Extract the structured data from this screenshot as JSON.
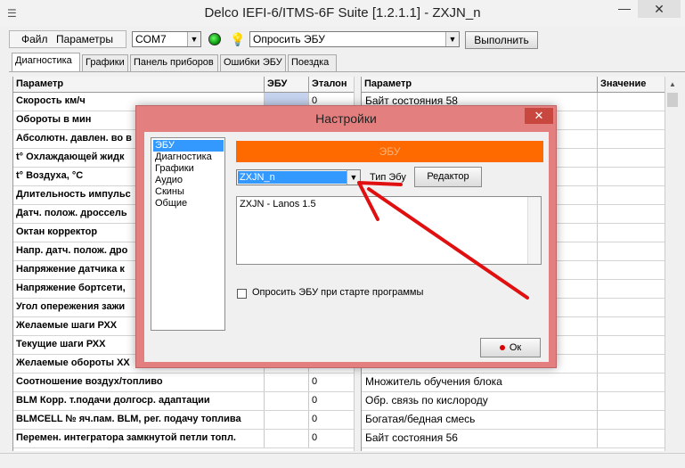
{
  "window": {
    "title": "Delco IEFI-6/ITMS-6F Suite [1.2.1.1] - ZXJN_n",
    "min_glyph": "—",
    "close_glyph": "✕",
    "app_icon": "app-menu-icon"
  },
  "toolbar": {
    "menu": [
      "Файл",
      "Параметры"
    ],
    "port": "COM7",
    "action": "Опросить ЭБУ",
    "execute_label": "Выполнить",
    "led_color": "#00a000"
  },
  "tabs": [
    {
      "label": "Диагностика",
      "active": true
    },
    {
      "label": "Графики",
      "active": false
    },
    {
      "label": "Панель приборов",
      "active": false
    },
    {
      "label": "Ошибки ЭБУ",
      "active": false
    },
    {
      "label": "Поездка",
      "active": false
    }
  ],
  "left_table": {
    "headers": [
      "Параметр",
      "ЭБУ",
      "Эталон"
    ],
    "rows": [
      {
        "name": "Скорость км/ч",
        "ebu": "",
        "ref": "0"
      },
      {
        "name": "Обороты в мин",
        "ebu": "",
        "ref": ""
      },
      {
        "name": "Абсолютн. давлен. во в",
        "ebu": "",
        "ref": ""
      },
      {
        "name": "t° Охлаждающей жидк",
        "ebu": "",
        "ref": ""
      },
      {
        "name": "t° Воздуха, °C",
        "ebu": "",
        "ref": ""
      },
      {
        "name": "Длительность импульс",
        "ebu": "",
        "ref": ""
      },
      {
        "name": "Датч. полож. дроссель",
        "ebu": "",
        "ref": ""
      },
      {
        "name": "Октан корректор",
        "ebu": "",
        "ref": ""
      },
      {
        "name": "Напр. датч. полож. дро",
        "ebu": "",
        "ref": ""
      },
      {
        "name": "Напряжение датчика к",
        "ebu": "",
        "ref": ""
      },
      {
        "name": "Напряжение бортсети,",
        "ebu": "",
        "ref": ""
      },
      {
        "name": "Угол опережения зажи",
        "ebu": "",
        "ref": ""
      },
      {
        "name": "Желаемые шаги РХХ",
        "ebu": "",
        "ref": ""
      },
      {
        "name": "Текущие шаги РХХ",
        "ebu": "",
        "ref": ""
      },
      {
        "name": "Желаемые обороты ХХ",
        "ebu": "",
        "ref": ""
      },
      {
        "name": "Соотношение воздух/топливо",
        "ebu": "",
        "ref": "0"
      },
      {
        "name": "BLM Корр. т.подачи долгоср. адаптации",
        "ebu": "",
        "ref": "0"
      },
      {
        "name": "BLMCELL № яч.пам. BLM, рег. подачу топлива",
        "ebu": "",
        "ref": "0"
      },
      {
        "name": "Перемен. интегратора замкнутой петли топл.",
        "ebu": "",
        "ref": "0"
      }
    ]
  },
  "right_table": {
    "headers": [
      "Параметр",
      "Значение"
    ],
    "rows": [
      {
        "name": "Байт состояния 58",
        "value": ""
      },
      {
        "name": "",
        "value": ""
      },
      {
        "name": "",
        "value": ""
      },
      {
        "name": "",
        "value": ""
      },
      {
        "name": "",
        "value": ""
      },
      {
        "name": "",
        "value": ""
      },
      {
        "name": "",
        "value": ""
      },
      {
        "name": "",
        "value": ""
      },
      {
        "name": "",
        "value": ""
      },
      {
        "name": "",
        "value": ""
      },
      {
        "name": "",
        "value": ""
      },
      {
        "name": "",
        "value": ""
      },
      {
        "name": "",
        "value": ""
      },
      {
        "name": "",
        "value": ""
      },
      {
        "name": "",
        "value": ""
      },
      {
        "name": "Множитель обучения блока",
        "value": ""
      },
      {
        "name": "Обр. связь по кислороду",
        "value": ""
      },
      {
        "name": "Богатая/бедная смесь",
        "value": ""
      },
      {
        "name": "Байт состояния 56",
        "value": ""
      }
    ]
  },
  "dialog": {
    "title": "Настройки",
    "close_glyph": "✕",
    "nav": [
      "ЭБУ",
      "Диагностика",
      "Графики",
      "Аудио",
      "Скины",
      "Общие"
    ],
    "nav_selected": 0,
    "banner": "ЭБУ",
    "ecu_value": "ZXJN_n",
    "ecu_type_label": "Тип Эбу",
    "editor_label": "Редактор",
    "description": "ZXJN - Lanos 1.5",
    "poll_label": "Опросить ЭБУ при старте программы",
    "poll_checked": false,
    "ok_label": "Ок"
  },
  "colors": {
    "dialog_frame": "#e3807f",
    "banner": "#ff6a00",
    "selection": "#3399ff",
    "arrow": "#e01010"
  }
}
